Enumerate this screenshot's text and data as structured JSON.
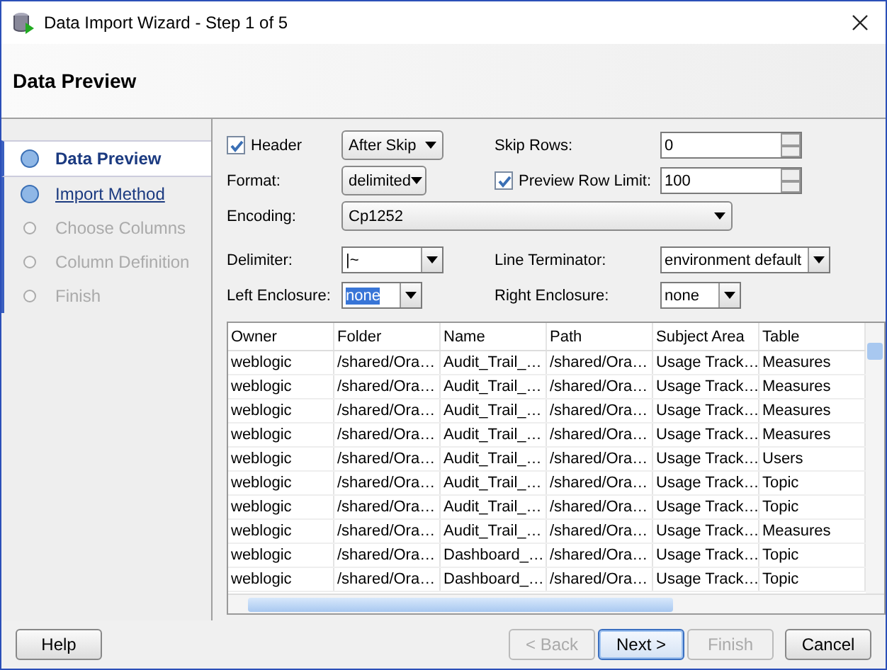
{
  "window": {
    "title": "Data Import Wizard - Step 1 of 5"
  },
  "header": {
    "title": "Data Preview"
  },
  "steps": [
    {
      "label": "Data Preview",
      "selected": true,
      "disabled": false
    },
    {
      "label": "Import Method",
      "selected": false,
      "disabled": false
    },
    {
      "label": "Choose Columns",
      "selected": false,
      "disabled": true
    },
    {
      "label": "Column Definition",
      "selected": false,
      "disabled": true
    },
    {
      "label": "Finish",
      "selected": false,
      "disabled": true
    }
  ],
  "form": {
    "header": {
      "label": "Header",
      "checked": true,
      "value": "After Skip"
    },
    "skip_rows": {
      "label": "Skip Rows:",
      "value": "0"
    },
    "format": {
      "label": "Format:",
      "value": "delimited"
    },
    "preview_row_limit": {
      "label": "Preview Row Limit:",
      "checked": true,
      "value": "100"
    },
    "encoding": {
      "label": "Encoding:",
      "value": "Cp1252"
    },
    "delimiter": {
      "label": "Delimiter:",
      "value": "|~"
    },
    "line_terminator": {
      "label": "Line Terminator:",
      "value": "environment default"
    },
    "left_enclosure": {
      "label": "Left Enclosure:",
      "value": "none"
    },
    "right_enclosure": {
      "label": "Right Enclosure:",
      "value": "none"
    }
  },
  "table": {
    "columns": [
      "Owner",
      "Folder",
      "Name",
      "Path",
      "Subject Area",
      "Table"
    ],
    "rows": [
      [
        "weblogic",
        "/shared/Ora…",
        "Audit_Trail_…",
        "/shared/Ora…",
        "Usage Track…",
        "Measures"
      ],
      [
        "weblogic",
        "/shared/Ora…",
        "Audit_Trail_…",
        "/shared/Ora…",
        "Usage Track…",
        "Measures"
      ],
      [
        "weblogic",
        "/shared/Ora…",
        "Audit_Trail_…",
        "/shared/Ora…",
        "Usage Track…",
        "Measures"
      ],
      [
        "weblogic",
        "/shared/Ora…",
        "Audit_Trail_…",
        "/shared/Ora…",
        "Usage Track…",
        "Measures"
      ],
      [
        "weblogic",
        "/shared/Ora…",
        "Audit_Trail_…",
        "/shared/Ora…",
        "Usage Track…",
        "Users"
      ],
      [
        "weblogic",
        "/shared/Ora…",
        "Audit_Trail_…",
        "/shared/Ora…",
        "Usage Track…",
        "Topic"
      ],
      [
        "weblogic",
        "/shared/Ora…",
        "Audit_Trail_…",
        "/shared/Ora…",
        "Usage Track…",
        "Topic"
      ],
      [
        "weblogic",
        "/shared/Ora…",
        "Audit_Trail_…",
        "/shared/Ora…",
        "Usage Track…",
        "Measures"
      ],
      [
        "weblogic",
        "/shared/Ora…",
        "Dashboard_…",
        "/shared/Ora…",
        "Usage Track…",
        "Topic"
      ],
      [
        "weblogic",
        "/shared/Ora…",
        "Dashboard_…",
        "/shared/Ora…",
        "Usage Track…",
        "Topic"
      ]
    ]
  },
  "buttons": [
    {
      "label": "Help",
      "disabled": false,
      "default": false
    },
    {
      "label": "< Back",
      "disabled": true,
      "default": false
    },
    {
      "label": "Next >",
      "disabled": false,
      "default": true
    },
    {
      "label": "Finish",
      "disabled": true,
      "default": false
    },
    {
      "label": "Cancel",
      "disabled": false,
      "default": false
    }
  ]
}
